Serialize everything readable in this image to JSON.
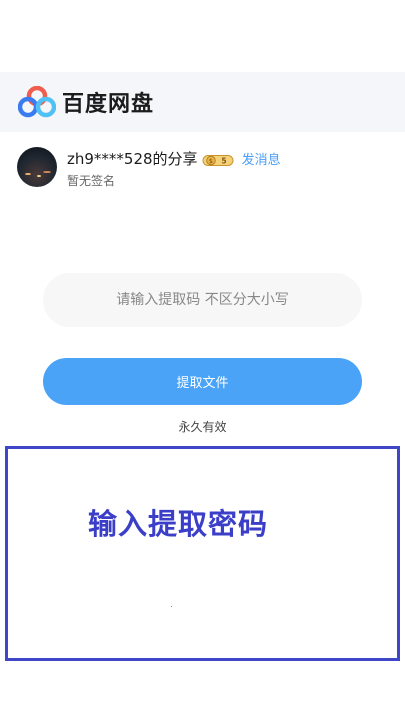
{
  "header": {
    "brand": "百度网盘",
    "logo_icon": "baidu-netdisk-logo-icon"
  },
  "sharer": {
    "name": "zh9****528的分享",
    "badge_icon": "vip-coin-badge-icon",
    "send_message": "发消息",
    "signature": "暂无签名"
  },
  "form": {
    "code_placeholder": "请输入提取码 不区分大小写",
    "code_value": "",
    "extract_button": "提取文件",
    "validity": "永久有效"
  },
  "annotation": {
    "text": "输入提取密码",
    "color": "#3b3fc8"
  },
  "colors": {
    "accent": "#4aa3f7",
    "link": "#4a9df8",
    "header_bg": "#f4f6fa"
  }
}
